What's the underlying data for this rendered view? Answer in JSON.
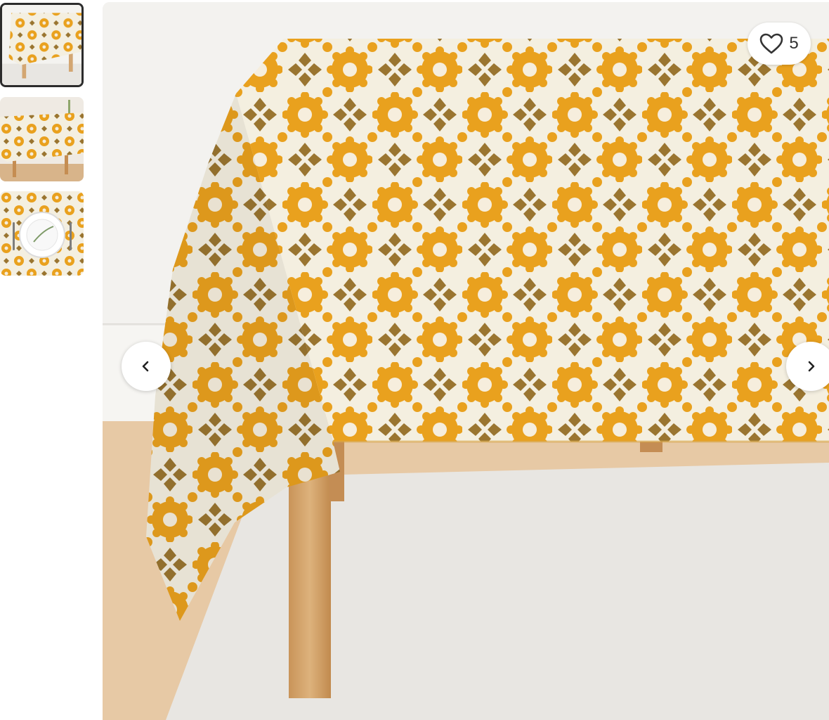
{
  "gallery": {
    "thumbnails": [
      {
        "name": "thumbnail-tablecloth-front",
        "selected": true
      },
      {
        "name": "thumbnail-tablecloth-room",
        "selected": false
      },
      {
        "name": "thumbnail-place-setting",
        "selected": false
      }
    ],
    "favorite": {
      "icon": "heart-icon",
      "count": "5"
    },
    "prev_icon": "chevron-left-icon",
    "next_icon": "chevron-right-icon"
  },
  "colors": {
    "pattern_orange": "#e9a11e",
    "pattern_brown": "#9a7530",
    "pattern_cream": "#f4efe0",
    "wall": "#f3f2ef",
    "floor": "#e7c9a5",
    "rug": "#e8e6e2",
    "table_leg": "#d3a672"
  }
}
